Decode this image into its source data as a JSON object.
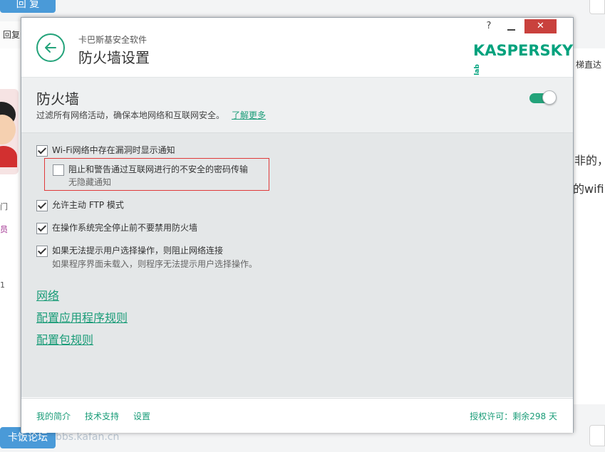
{
  "background": {
    "top_button": "回 复",
    "reply_label": "回复",
    "right_texts": [
      "梯直达",
      "非的，想",
      "的wifi"
    ],
    "left_small": [
      "门",
      "员",
      "1"
    ],
    "bottom_button": "卡饭论坛",
    "watermark": "bbs.kafan.cn"
  },
  "dialog": {
    "app_name": "卡巴斯基安全软件",
    "title": "防火墙设置",
    "help": "?",
    "close": "✕",
    "logo": "KASPERSKY",
    "logo_lab": "lab",
    "firewall": {
      "heading": "防火墙",
      "description": "过滤所有网络活动，确保本地网络和互联网安全。",
      "learn_more": "了解更多",
      "enabled": true
    },
    "options": [
      {
        "label": "Wi-Fi网络中存在漏洞时显示通知",
        "checked": true
      },
      {
        "label": "阻止和警告通过互联网进行的不安全的密码传输",
        "sub": "无隐藏通知",
        "checked": false
      },
      {
        "label": "允许主动 FTP 模式",
        "checked": true
      },
      {
        "label": "在操作系统完全停止前不要禁用防火墙",
        "checked": true
      },
      {
        "label": "如果无法提示用户选择操作，则阻止网络连接",
        "sub": "如果程序界面未载入，则程序无法提示用户选择操作。",
        "checked": true
      }
    ],
    "links": [
      "网络",
      "配置应用程序规则",
      "配置包规则"
    ],
    "footer": {
      "profile": "我的简介",
      "support": "技术支持",
      "settings": "设置",
      "license": "授权许可：剩余298 天"
    }
  },
  "colors": {
    "accent": "#23a37a",
    "close_red": "#c9413d",
    "highlight_red": "#e03a3a"
  }
}
